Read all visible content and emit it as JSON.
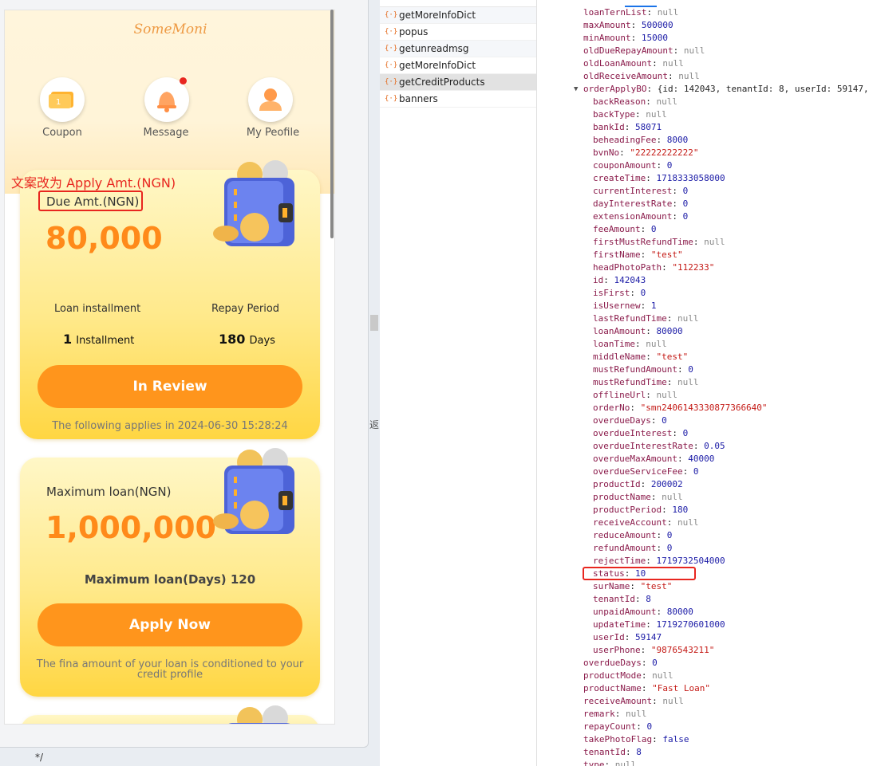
{
  "phone": {
    "logo": "SomeMoni",
    "quick_actions": [
      {
        "label": "Coupon",
        "icon": "coupon-icon"
      },
      {
        "label": "Message",
        "icon": "bell-icon"
      },
      {
        "label": "My Peofile",
        "icon": "user-icon"
      }
    ],
    "annotation": "文案改为 Apply Amt.(NGN)",
    "card1": {
      "title": "Due Amt.(NGN)",
      "amount": "80,000",
      "left_label": "Loan installment",
      "right_label": "Repay Period",
      "left_num": "1",
      "left_unit": "Installment",
      "right_num": "180",
      "right_unit": "Days",
      "button": "In Review",
      "note": "The following applies in 2024-06-30 15:28:24"
    },
    "card2": {
      "title": "Maximum loan(NGN)",
      "amount": "1,000,000",
      "days": "Maximum loan(Days) 120",
      "button": "Apply Now",
      "note": "The fina amount of your loan is conditioned to your credit profile"
    }
  },
  "bottom_text": "*/",
  "side_char": "返",
  "network": {
    "requests": [
      "getMoreInfoDict",
      "popus",
      "getunreadmsg",
      "getMoreInfoDict",
      "getCreditProducts",
      "banners"
    ],
    "selected_index": 4
  },
  "json_lines": [
    {
      "indent": 1,
      "key": "loanTernList",
      "val": "null",
      "t": "nl"
    },
    {
      "indent": 1,
      "key": "maxAmount",
      "val": "500000",
      "t": "n"
    },
    {
      "indent": 1,
      "key": "minAmount",
      "val": "15000",
      "t": "n"
    },
    {
      "indent": 1,
      "key": "oldDueRepayAmount",
      "val": "null",
      "t": "nl"
    },
    {
      "indent": 1,
      "key": "oldLoanAmount",
      "val": "null",
      "t": "nl"
    },
    {
      "indent": 1,
      "key": "oldReceiveAmount",
      "val": "null",
      "t": "nl"
    },
    {
      "indent": 1,
      "key": "orderApplyBO",
      "val": "{id: 142043, tenantId: 8, userId: 59147,",
      "t": "plain",
      "arrow": true
    },
    {
      "indent": 2,
      "key": "backReason",
      "val": "null",
      "t": "nl"
    },
    {
      "indent": 2,
      "key": "backType",
      "val": "null",
      "t": "nl"
    },
    {
      "indent": 2,
      "key": "bankId",
      "val": "58071",
      "t": "n"
    },
    {
      "indent": 2,
      "key": "beheadingFee",
      "val": "8000",
      "t": "n"
    },
    {
      "indent": 2,
      "key": "bvnNo",
      "val": "\"22222222222\"",
      "t": "s"
    },
    {
      "indent": 2,
      "key": "couponAmount",
      "val": "0",
      "t": "n"
    },
    {
      "indent": 2,
      "key": "createTime",
      "val": "1718333058000",
      "t": "n"
    },
    {
      "indent": 2,
      "key": "currentInterest",
      "val": "0",
      "t": "n"
    },
    {
      "indent": 2,
      "key": "dayInterestRate",
      "val": "0",
      "t": "n"
    },
    {
      "indent": 2,
      "key": "extensionAmount",
      "val": "0",
      "t": "n"
    },
    {
      "indent": 2,
      "key": "feeAmount",
      "val": "0",
      "t": "n"
    },
    {
      "indent": 2,
      "key": "firstMustRefundTime",
      "val": "null",
      "t": "nl"
    },
    {
      "indent": 2,
      "key": "firstName",
      "val": "\"test\"",
      "t": "s"
    },
    {
      "indent": 2,
      "key": "headPhotoPath",
      "val": "\"112233\"",
      "t": "s"
    },
    {
      "indent": 2,
      "key": "id",
      "val": "142043",
      "t": "n"
    },
    {
      "indent": 2,
      "key": "isFirst",
      "val": "0",
      "t": "n"
    },
    {
      "indent": 2,
      "key": "isUsernew",
      "val": "1",
      "t": "n"
    },
    {
      "indent": 2,
      "key": "lastRefundTime",
      "val": "null",
      "t": "nl"
    },
    {
      "indent": 2,
      "key": "loanAmount",
      "val": "80000",
      "t": "n"
    },
    {
      "indent": 2,
      "key": "loanTime",
      "val": "null",
      "t": "nl"
    },
    {
      "indent": 2,
      "key": "middleName",
      "val": "\"test\"",
      "t": "s"
    },
    {
      "indent": 2,
      "key": "mustRefundAmount",
      "val": "0",
      "t": "n"
    },
    {
      "indent": 2,
      "key": "mustRefundTime",
      "val": "null",
      "t": "nl"
    },
    {
      "indent": 2,
      "key": "offlineUrl",
      "val": "null",
      "t": "nl"
    },
    {
      "indent": 2,
      "key": "orderNo",
      "val": "\"smn2406143330877366640\"",
      "t": "s"
    },
    {
      "indent": 2,
      "key": "overdueDays",
      "val": "0",
      "t": "n"
    },
    {
      "indent": 2,
      "key": "overdueInterest",
      "val": "0",
      "t": "n"
    },
    {
      "indent": 2,
      "key": "overdueInterestRate",
      "val": "0.05",
      "t": "n"
    },
    {
      "indent": 2,
      "key": "overdueMaxAmount",
      "val": "40000",
      "t": "n"
    },
    {
      "indent": 2,
      "key": "overdueServiceFee",
      "val": "0",
      "t": "n"
    },
    {
      "indent": 2,
      "key": "productId",
      "val": "200002",
      "t": "n"
    },
    {
      "indent": 2,
      "key": "productName",
      "val": "null",
      "t": "nl"
    },
    {
      "indent": 2,
      "key": "productPeriod",
      "val": "180",
      "t": "n"
    },
    {
      "indent": 2,
      "key": "receiveAccount",
      "val": "null",
      "t": "nl"
    },
    {
      "indent": 2,
      "key": "reduceAmount",
      "val": "0",
      "t": "n"
    },
    {
      "indent": 2,
      "key": "refundAmount",
      "val": "0",
      "t": "n"
    },
    {
      "indent": 2,
      "key": "rejectTime",
      "val": "1719732504000",
      "t": "n"
    },
    {
      "indent": 2,
      "key": "status",
      "val": "10",
      "t": "n",
      "highlight": true
    },
    {
      "indent": 2,
      "key": "surName",
      "val": "\"test\"",
      "t": "s"
    },
    {
      "indent": 2,
      "key": "tenantId",
      "val": "8",
      "t": "n"
    },
    {
      "indent": 2,
      "key": "unpaidAmount",
      "val": "80000",
      "t": "n"
    },
    {
      "indent": 2,
      "key": "updateTime",
      "val": "1719270601000",
      "t": "n"
    },
    {
      "indent": 2,
      "key": "userId",
      "val": "59147",
      "t": "n"
    },
    {
      "indent": 2,
      "key": "userPhone",
      "val": "\"9876543211\"",
      "t": "s"
    },
    {
      "indent": 1,
      "key": "overdueDays",
      "val": "0",
      "t": "n"
    },
    {
      "indent": 1,
      "key": "productMode",
      "val": "null",
      "t": "nl"
    },
    {
      "indent": 1,
      "key": "productName",
      "val": "\"Fast Loan\"",
      "t": "s"
    },
    {
      "indent": 1,
      "key": "receiveAmount",
      "val": "null",
      "t": "nl"
    },
    {
      "indent": 1,
      "key": "remark",
      "val": "null",
      "t": "nl"
    },
    {
      "indent": 1,
      "key": "repayCount",
      "val": "0",
      "t": "n"
    },
    {
      "indent": 1,
      "key": "takePhotoFlag",
      "val": "false",
      "t": "n"
    },
    {
      "indent": 1,
      "key": "tenantId",
      "val": "8",
      "t": "n"
    },
    {
      "indent": 1,
      "key": "type",
      "val": "null",
      "t": "nl"
    }
  ]
}
